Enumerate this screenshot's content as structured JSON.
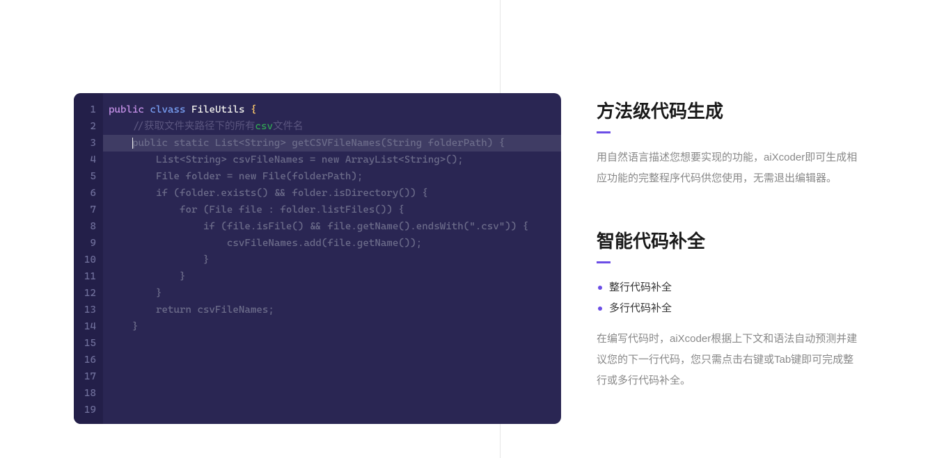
{
  "editor": {
    "line_count": 19,
    "highlight_row": 3,
    "tokens": {
      "l1_public": "public",
      "l1_clvass": "clvass",
      "l1_fileutils": "FileUtils",
      "l1_brace": "{",
      "l2_indent": "    ",
      "l2_comment_prefix": "//获取文件夹路径下的所有",
      "l2_csv": "csv",
      "l2_comment_suffix": "文件名",
      "l3_indent": "    ",
      "l3_suggest": "public static List<String> getCSVFileNames(String folderPath) {",
      "l4": "        List<String> csvFileNames = new ArrayList<String>();",
      "l5": "        File folder = new File(folderPath);",
      "l6": "        if (folder.exists() && folder.isDirectory()) {",
      "l7": "            for (File file : folder.listFiles()) {",
      "l8": "                if (file.isFile() && file.getName().endsWith(\".csv\")) {",
      "l9": "                    csvFileNames.add(file.getName());",
      "l10": "                }",
      "l11": "            }",
      "l12": "        }",
      "l13": "        return csvFileNames;",
      "l14": "    }"
    }
  },
  "features": {
    "gen": {
      "title": "方法级代码生成",
      "desc": "用自然语言描述您想要实现的功能，aiXcoder即可生成相应功能的完整程序代码供您使用，无需退出编辑器。"
    },
    "complete": {
      "title": "智能代码补全",
      "bullets": [
        "整行代码补全",
        "多行代码补全"
      ],
      "desc": "在编写代码时，aiXcoder根据上下文和语法自动预测并建议您的下一行代码，您只需点击右键或Tab键即可完成整行或多行代码补全。"
    }
  }
}
